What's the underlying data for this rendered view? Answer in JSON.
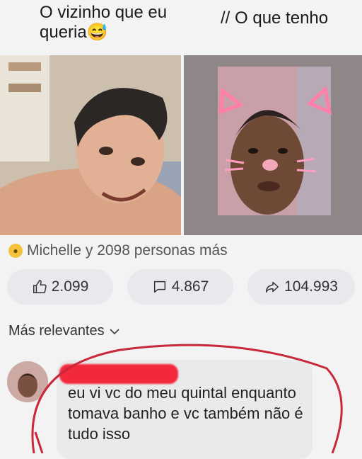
{
  "captions": {
    "left": "O vizinho que eu queria",
    "left_emoji": "😅",
    "right": "// O que tenho"
  },
  "reactions": {
    "summary": "Michelle y 2098 personas más",
    "emoji_icon": "laughing-emoji-icon"
  },
  "actions": {
    "like_count": "2.099",
    "comment_count": "4.867",
    "share_count": "104.993"
  },
  "comments": {
    "sort_label": "Más relevantes",
    "first_comment_text": "eu vi vc do meu quintal enquanto tomava banho e vc também não é tudo isso"
  },
  "colors": {
    "redaction": "#f2293a",
    "annotation_circle": "#c8283a",
    "pill_bg": "#e7e9ec"
  }
}
